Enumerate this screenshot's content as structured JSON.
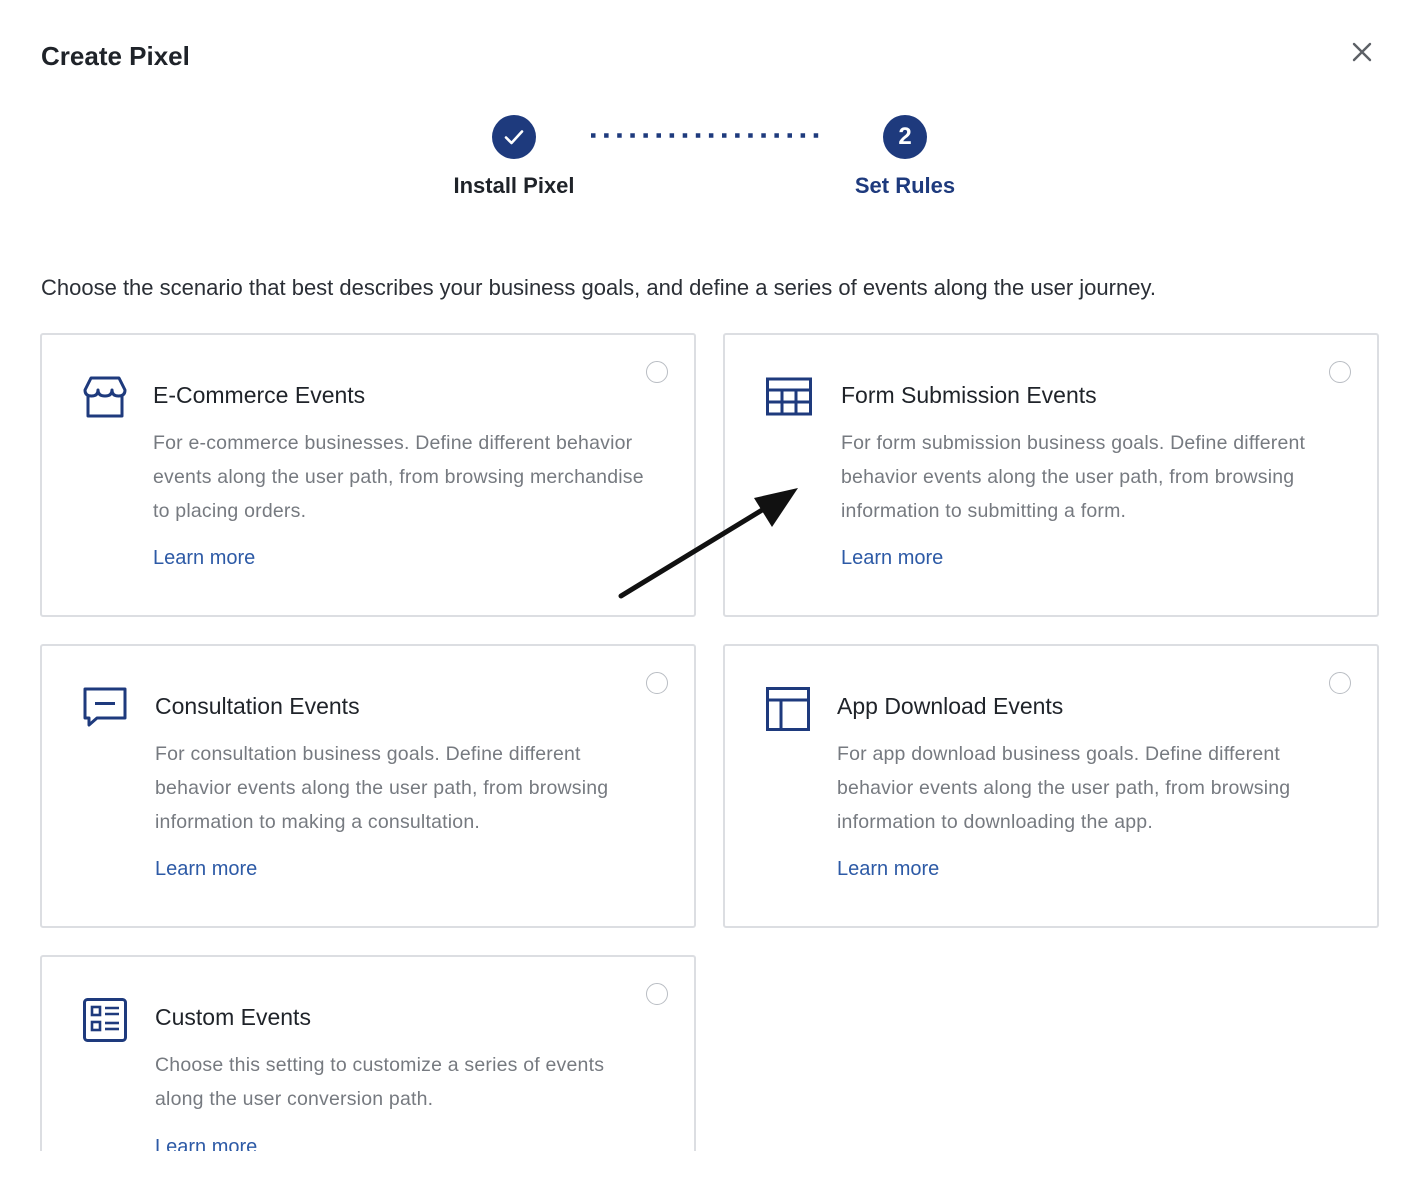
{
  "dialog": {
    "title": "Create Pixel"
  },
  "stepper": {
    "steps": [
      {
        "label": "Install Pixel",
        "state": "completed",
        "number": "1"
      },
      {
        "label": "Set Rules",
        "state": "active",
        "number": "2"
      }
    ]
  },
  "intro": {
    "text": "Choose the scenario that best describes your business goals, and define a series of events along the user journey."
  },
  "cards": [
    {
      "icon": "store-icon",
      "title": "E-Commerce Events",
      "description": "For e-commerce businesses. Define different behavior events along the user path, from browsing merchandise to placing orders.",
      "link": "Learn more",
      "selected": false
    },
    {
      "icon": "table-icon",
      "title": "Form Submission Events",
      "description": "For form submission business goals. Define different behavior events along the user path, from browsing information to submitting a form.",
      "link": "Learn more",
      "selected": false
    },
    {
      "icon": "chat-icon",
      "title": "Consultation Events",
      "description": "For consultation business goals. Define different behavior events along the user path, from browsing information to making a consultation.",
      "link": "Learn more",
      "selected": false
    },
    {
      "icon": "layout-icon",
      "title": "App Download Events",
      "description": "For app download business goals. Define different behavior events along the user path, from browsing information to downloading the app.",
      "link": "Learn more",
      "selected": false
    },
    {
      "icon": "list-icon",
      "title": "Custom Events",
      "description": "Choose this setting to customize a series of events along the user conversion path.",
      "link": "Learn more",
      "selected": false
    }
  ],
  "colors": {
    "primary": "#1e3a7d",
    "link": "#2d5aa6",
    "border": "#dcdee2",
    "text": "#1f2329",
    "muted": "#767a80"
  }
}
